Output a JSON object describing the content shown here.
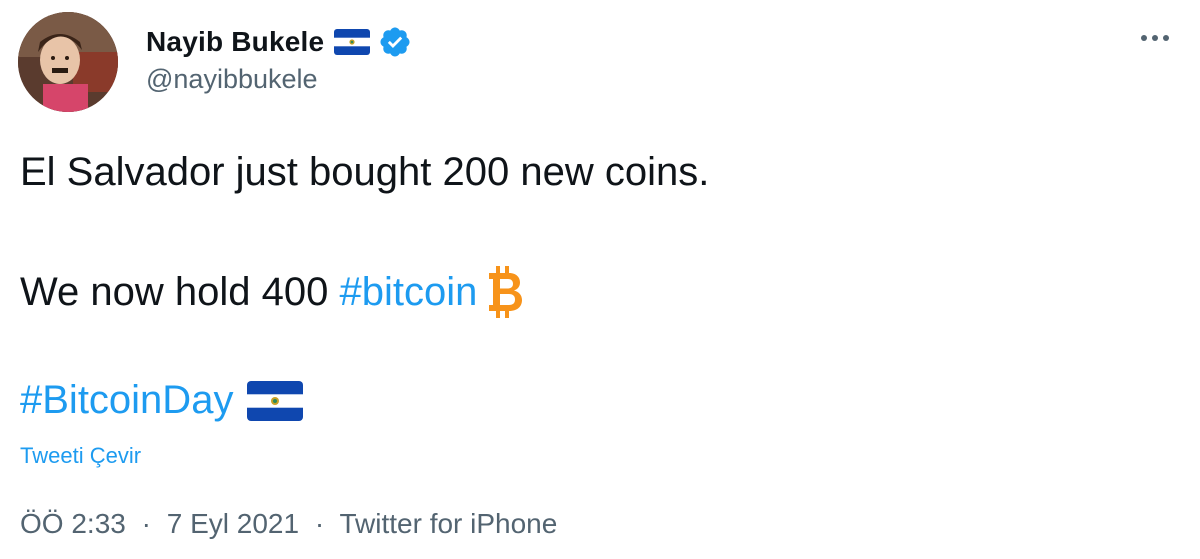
{
  "author": {
    "display_name": "Nayib Bukele",
    "handle": "@nayibbukele",
    "verified": true,
    "flag_icon": "el-salvador-flag-icon"
  },
  "tweet": {
    "line1": "El Salvador just bought 200 new coins.",
    "line2_prefix": "We now hold 400 ",
    "line2_hashtag": "#bitcoin",
    "line2_icon": "bitcoin-icon",
    "line3_hashtag": "#BitcoinDay",
    "line3_icon": "el-salvador-flag-icon"
  },
  "translate_label": "Tweeti Çevir",
  "meta": {
    "time": "ÖÖ 2:33",
    "separator": "·",
    "date": "7 Eyl 2021",
    "source": "Twitter for iPhone"
  },
  "colors": {
    "link": "#1d9bf0",
    "secondary_text": "#536471",
    "verified_badge": "#1d9bf0",
    "bitcoin": "#f7931a",
    "flag_blue": "#0f47af"
  }
}
